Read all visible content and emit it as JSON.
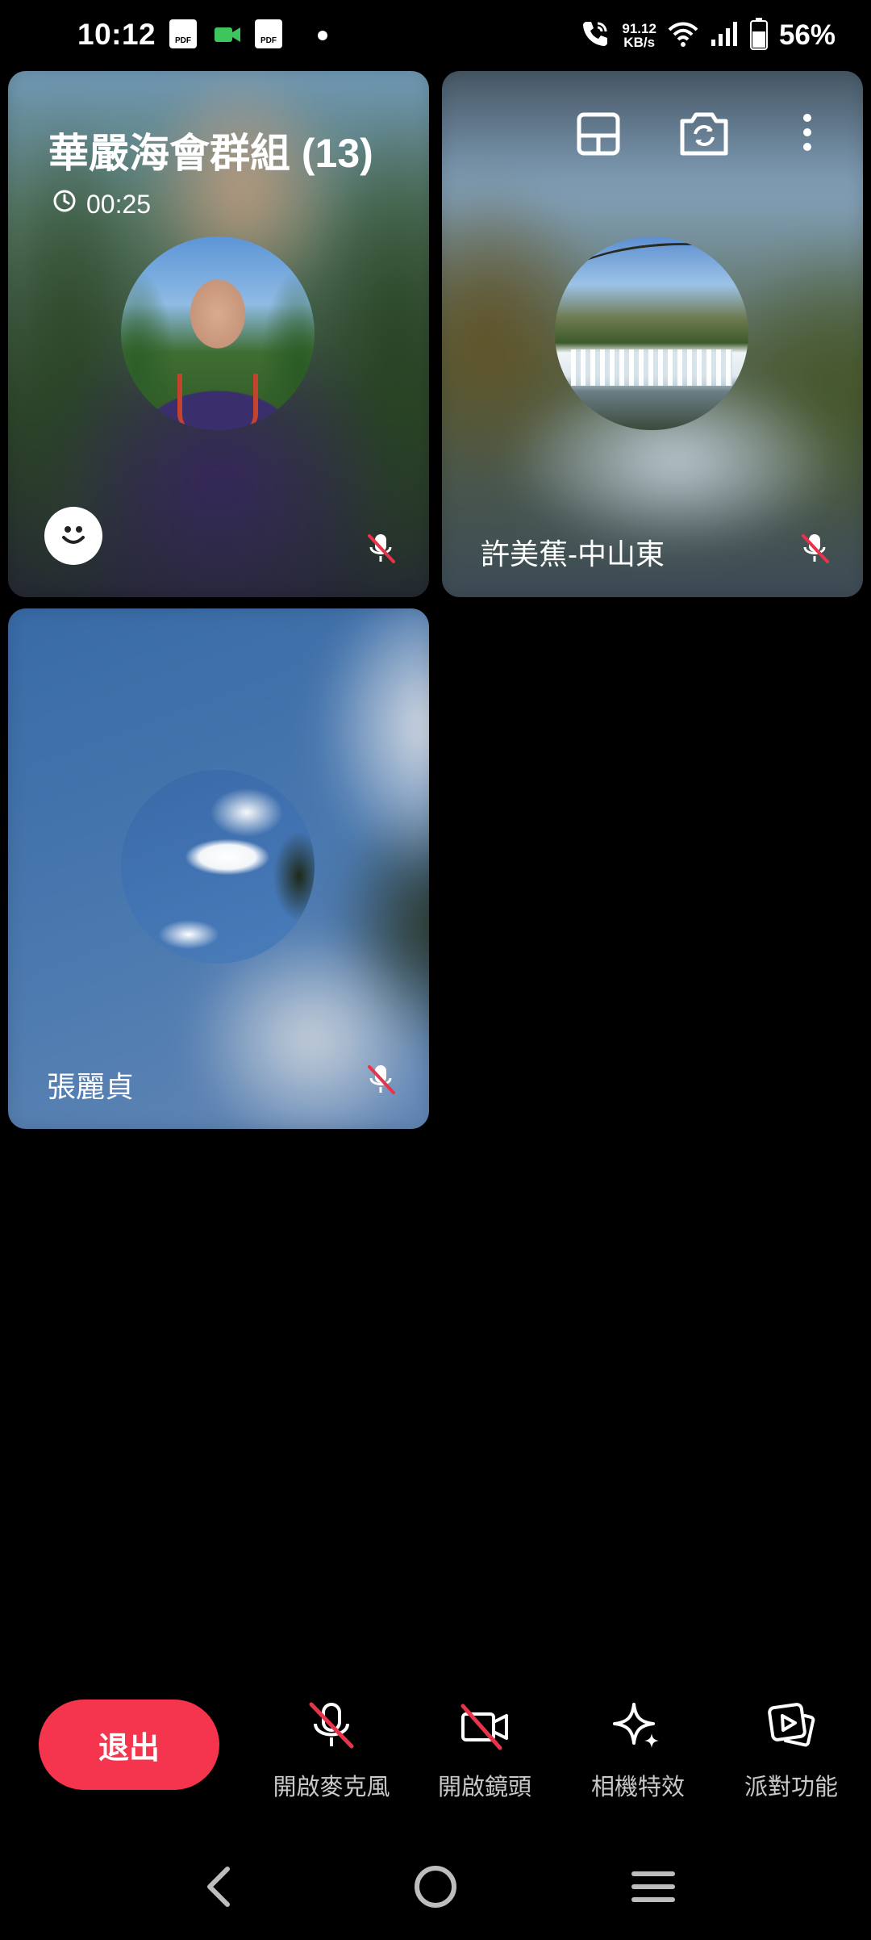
{
  "status_bar": {
    "time": "10:12",
    "net_speed_value": "91.12",
    "net_speed_unit": "KB/s",
    "battery_percent": "56%",
    "notification_icons": [
      "pdf-icon",
      "video-call-icon",
      "pdf-icon",
      "dot-icon"
    ],
    "system_icons": [
      "wifi-call-icon",
      "wifi-icon",
      "signal-icon",
      "battery-icon"
    ]
  },
  "call": {
    "group_title": "華嚴海會群組 (13)",
    "duration": "00:25"
  },
  "participants": [
    {
      "name": "",
      "muted": true,
      "is_self": true
    },
    {
      "name": "許美蕉-中山東",
      "muted": true
    },
    {
      "name": "張麗貞",
      "muted": true
    }
  ],
  "top_actions": [
    "layout-icon",
    "switch-camera-icon",
    "more-icon"
  ],
  "controls": {
    "exit_label": "退出",
    "mic_label": "開啟麥克風",
    "camera_label": "開啟鏡頭",
    "effects_label": "相機特效",
    "party_label": "派對功能"
  },
  "colors": {
    "exit_button": "#f4354d",
    "mute_slash": "#e8344a",
    "video_icon": "#3ec55b",
    "background": "#000000"
  }
}
